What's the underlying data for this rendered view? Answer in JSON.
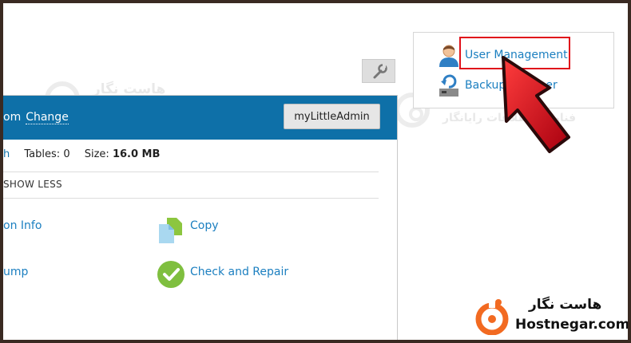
{
  "watermark": {
    "fa_title": "هاست نگار",
    "fa_subtitle": "فناوری اطلاعات رایانگار"
  },
  "db_panel": {
    "header_prefix": "om",
    "header_change": "Change",
    "mla_button": "myLittleAdmin",
    "stats": {
      "refresh_fragment": "h",
      "tables_label": "Tables:",
      "tables_value": "0",
      "size_label": "Size:",
      "size_value": "16.0 MB"
    },
    "show_less": "SHOW LESS",
    "tools": {
      "connection_info": "on Info",
      "copy": "Copy",
      "dump": "ump",
      "check_repair": "Check and Repair"
    }
  },
  "right_box": {
    "user_management": "User Management",
    "backup": "Backup",
    "backup_tail": "er"
  },
  "brand": {
    "fa": "هاست نگار",
    "en": "Hostnegar.com"
  },
  "colors": {
    "header_blue": "#0e70a8",
    "link_blue": "#1b7fc0",
    "highlight_red": "#e0101a",
    "arrow_red": "#c8101c",
    "brand_orange": "#f26a21"
  }
}
